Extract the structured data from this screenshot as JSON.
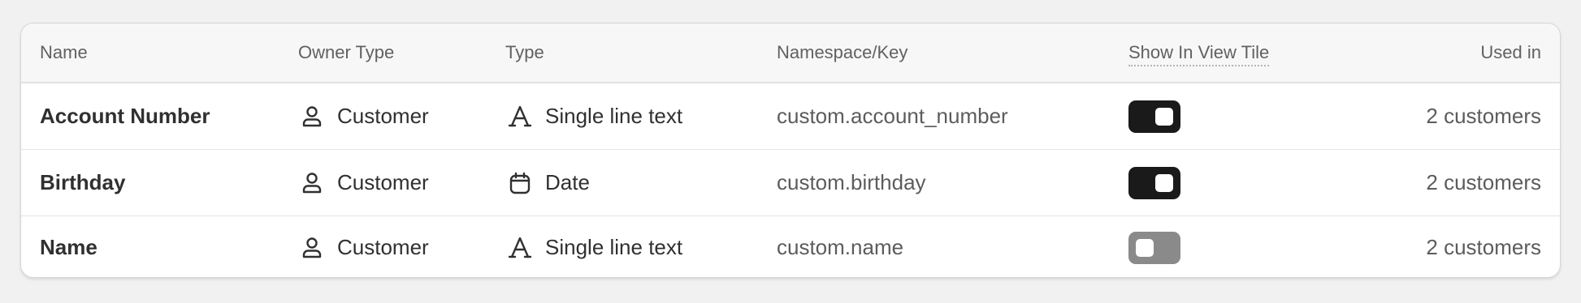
{
  "columns": {
    "name": "Name",
    "owner_type": "Owner Type",
    "type": "Type",
    "namespace_key": "Namespace/Key",
    "show_in_view_tile": "Show In View Tile",
    "used_in": "Used in"
  },
  "rows": [
    {
      "name": "Account Number",
      "owner_type": "Customer",
      "owner_icon": "person-icon",
      "type": "Single line text",
      "type_icon": "text-format-icon",
      "namespace_key": "custom.account_number",
      "show_in_view_tile": true,
      "used_in": "2 customers"
    },
    {
      "name": "Birthday",
      "owner_type": "Customer",
      "owner_icon": "person-icon",
      "type": "Date",
      "type_icon": "calendar-icon",
      "namespace_key": "custom.birthday",
      "show_in_view_tile": true,
      "used_in": "2 customers"
    },
    {
      "name": "Name",
      "owner_type": "Customer",
      "owner_icon": "person-icon",
      "type": "Single line text",
      "type_icon": "text-format-icon",
      "namespace_key": "custom.name",
      "show_in_view_tile": false,
      "used_in": "2 customers"
    }
  ],
  "colors": {
    "toggle_on": "#1a1a1a",
    "toggle_off": "#8a8a8a",
    "text_primary": "#303030",
    "text_secondary": "#5c5c5c",
    "header_bg": "#f7f7f7"
  }
}
